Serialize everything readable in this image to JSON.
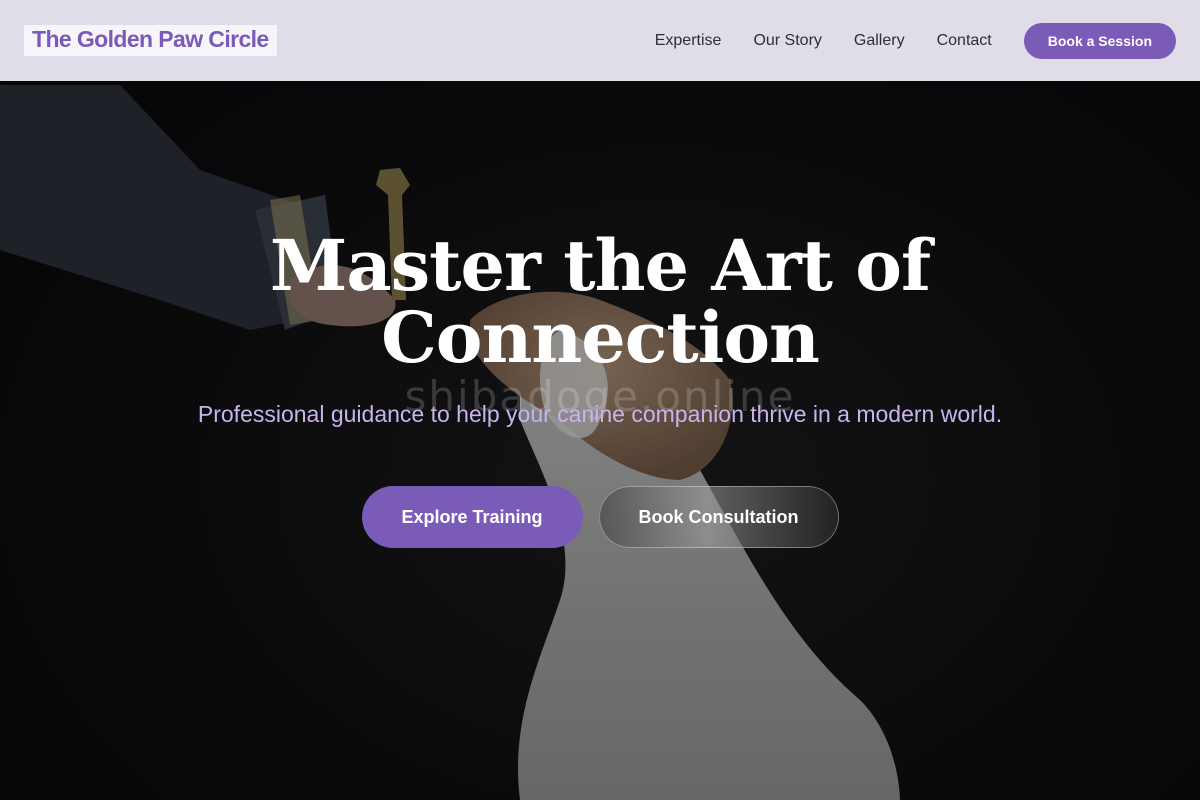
{
  "header": {
    "logo_text": "The Golden Paw Circle",
    "nav_items": [
      "Expertise",
      "Our Story",
      "Gallery",
      "Contact"
    ],
    "cta_label": "Book a Session"
  },
  "hero": {
    "title_line1": "Master the Art of",
    "title_line2": "Connection",
    "subtitle": "Professional guidance to help your canine companion thrive in a modern world.",
    "watermark": "shibadoge.online",
    "primary_button": "Explore Training",
    "secondary_button": "Book Consultation"
  },
  "colors": {
    "accent": "#7a5bb8",
    "header_bg": "#e7e4f0",
    "subtitle": "#c9b3ef"
  }
}
